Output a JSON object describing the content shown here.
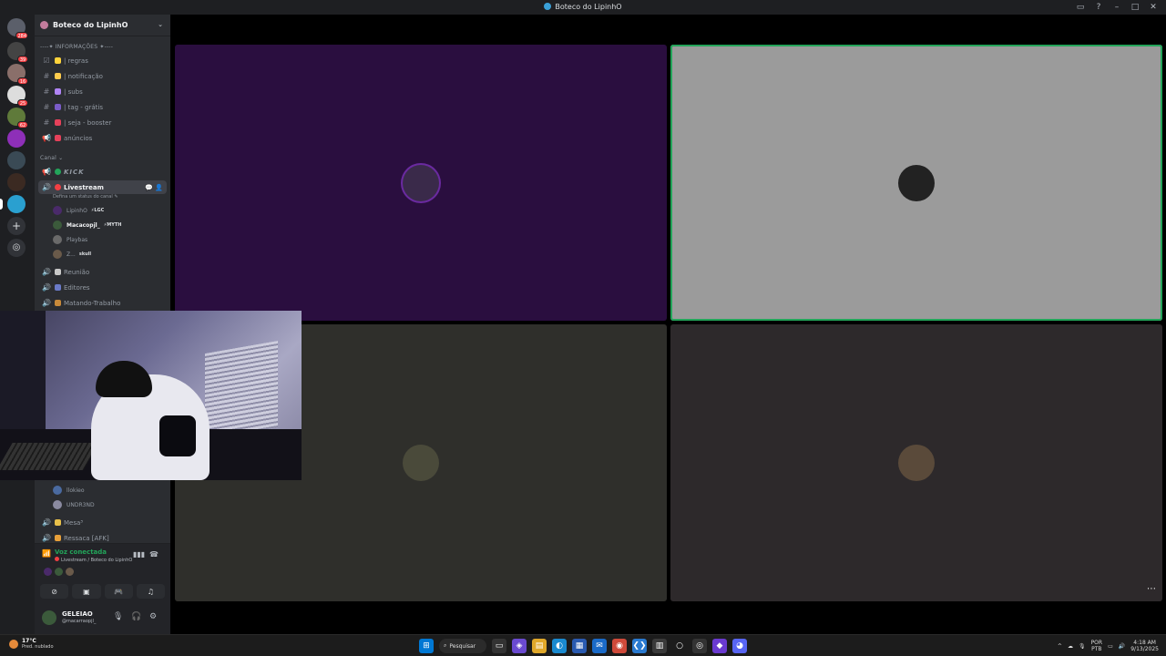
{
  "window": {
    "title": "Boteco do LipinhO"
  },
  "rail": {
    "servers": [
      {
        "badge": "284",
        "color": "#5b5f6a"
      },
      {
        "badge": "39",
        "color": "#444444"
      },
      {
        "badge": "16",
        "color": "#8a6f6a"
      },
      {
        "badge": "25",
        "color": "#dddddd"
      },
      {
        "badge": "62",
        "color": "#5f7a3a"
      },
      {
        "badge": "",
        "color": "#8e2fb8"
      },
      {
        "badge": "",
        "color": "#3a4a55"
      },
      {
        "badge": "",
        "color": "#3b2a22"
      },
      {
        "badge": "",
        "color": "#2aa0d0"
      }
    ]
  },
  "sidebar": {
    "server_name": "Boteco do LipinhO",
    "category_info": "----✦ INFORMAÇÕES ✦----",
    "text_channels": [
      {
        "name": "| regras",
        "emoji_color": "#ffd43b"
      },
      {
        "name": "| notificação",
        "emoji_color": "#ffcc4d"
      },
      {
        "name": "| subs",
        "emoji_color": "#b084f5"
      },
      {
        "name": "| tag - grátis",
        "emoji_color": "#7a5cc8"
      },
      {
        "name": "| seja - booster",
        "emoji_color": "#e6415a"
      },
      {
        "name": "anúncios",
        "emoji_color": "#e6415a"
      }
    ],
    "category_canal": "Canal",
    "kick_channel": "KICK",
    "active_channel": {
      "name": "Livestream",
      "status_hint": "Defina um status do canal"
    },
    "voice_users": [
      {
        "name": "LipinhO",
        "tag": "⚡LGC",
        "bright": false,
        "color": "#4a2a6a"
      },
      {
        "name": "Macacopjl_",
        "tag": "⚡MYTH",
        "bright": true,
        "color": "#3b5a3b"
      },
      {
        "name": "Playbas",
        "tag": "",
        "bright": false,
        "color": "#6a6a6a"
      },
      {
        "name": "Z...",
        "tag": "skull",
        "bright": false,
        "color": "#6a5a4a"
      }
    ],
    "voice_channels_mid": [
      {
        "name": "Reunião",
        "emoji_color": "#c8c8c8"
      },
      {
        "name": "Editores",
        "emoji_color": "#6a7ac8"
      },
      {
        "name": "Matando-Trabalho",
        "emoji_color": "#c88a3a"
      }
    ],
    "lower_users": [
      {
        "name": "llokieo",
        "color": "#4a6aa0"
      },
      {
        "name": "UNDR3ND",
        "color": "#8a8aa0"
      }
    ],
    "voice_channels_low": [
      {
        "name": "Mesa³",
        "emoji_color": "#e8c04a"
      },
      {
        "name": "Ressaca [AFK]",
        "emoji_color": "#e8a03a"
      }
    ]
  },
  "voice_panel": {
    "status": "Voz conectada",
    "location": "Livestream / Boteco do LipinhO"
  },
  "user_panel": {
    "username": "GELEIAO",
    "status": "@macarraopjl_"
  },
  "stage": {
    "tiles": [
      {
        "bg": "#2a0e3f",
        "speaking": false,
        "avatar": "#3a2a4a"
      },
      {
        "bg": "#9b9b9b",
        "speaking": true,
        "avatar": "#222222"
      },
      {
        "bg": "#2f2f2b",
        "speaking": false,
        "avatar": "#4a4a3a"
      },
      {
        "bg": "#2d292b",
        "speaking": false,
        "avatar": "#5a4a3a"
      }
    ]
  },
  "taskbar": {
    "weather_temp": "17°C",
    "weather_desc": "Pred. nublado",
    "search": "Pesquisar",
    "lang_1": "POR",
    "lang_2": "PTB",
    "time": "4:18 AM",
    "date": "9/13/2025"
  }
}
